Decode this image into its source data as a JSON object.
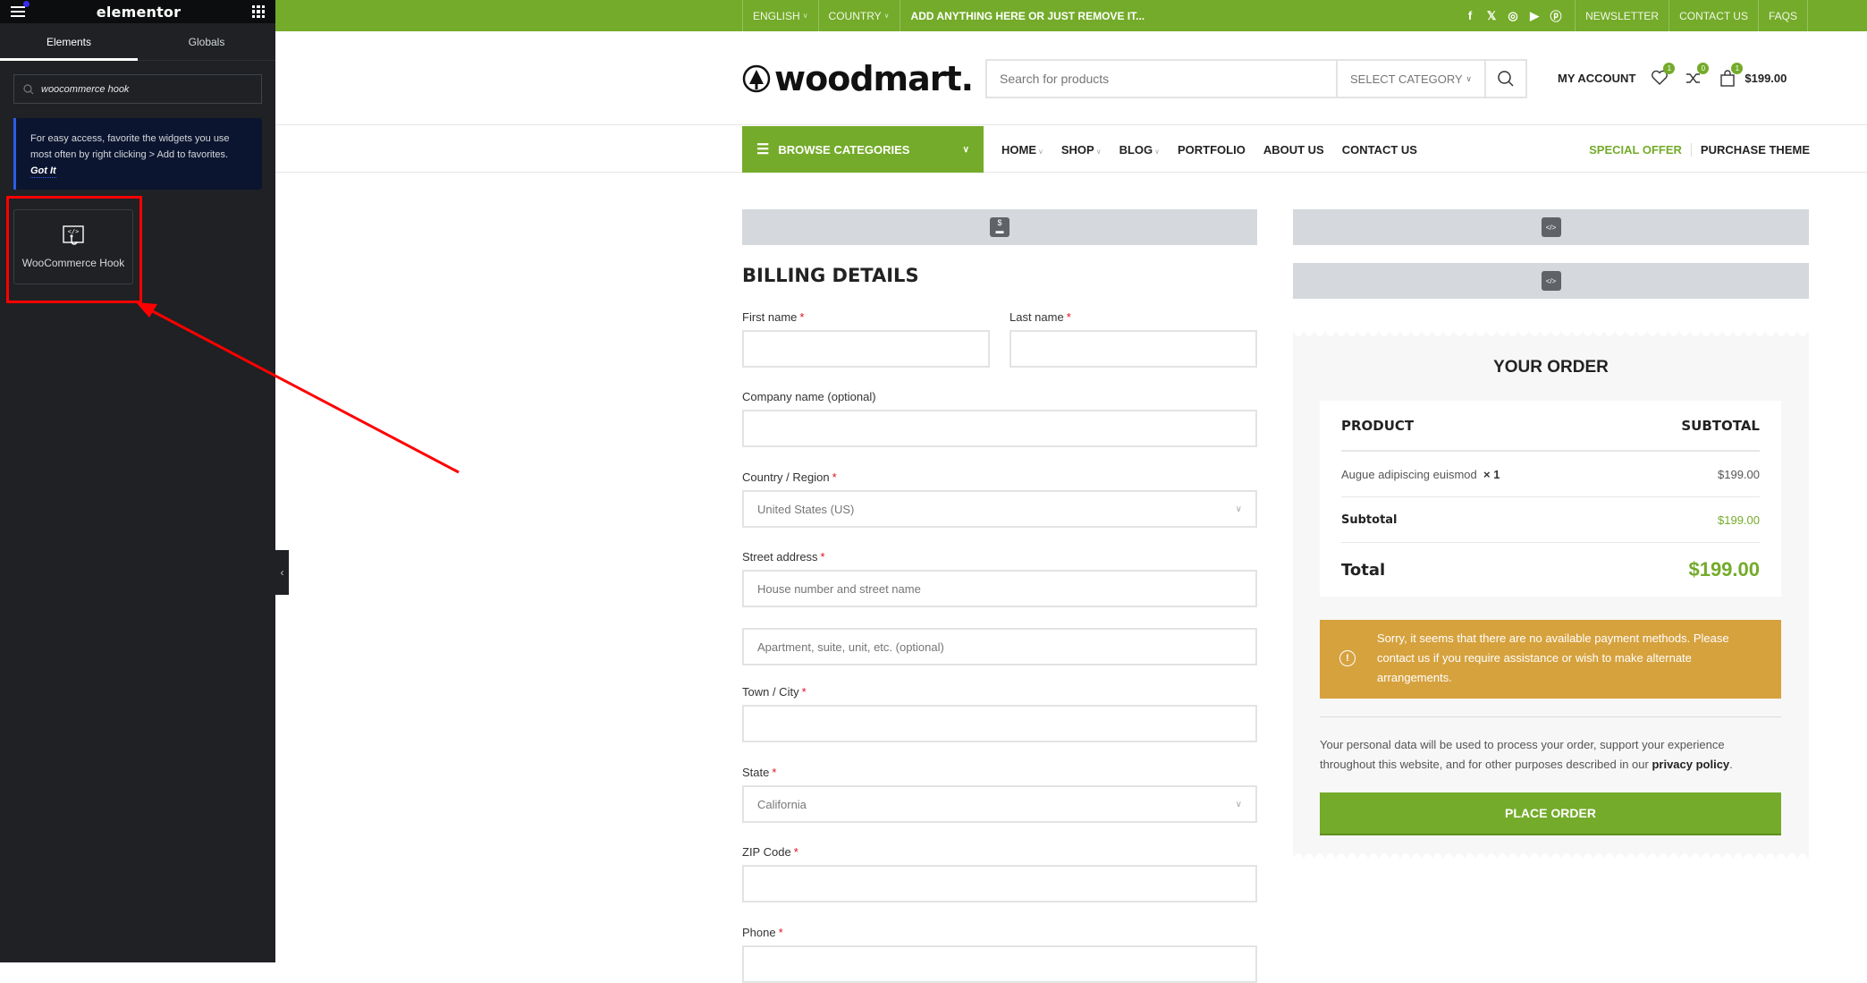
{
  "editor": {
    "brand": "elementor",
    "tabs": [
      "Elements",
      "Globals"
    ],
    "search_value": "woocommerce hook",
    "tip_text": "For easy access, favorite the widgets you use most often by right clicking > Add to favorites.",
    "tip_action": "Got It",
    "widget_label": "WooCommerce Hook"
  },
  "topbar": {
    "language": "ENGLISH",
    "country": "COUNTRY",
    "promo": "ADD ANYTHING HERE OR JUST REMOVE IT...",
    "social": [
      "f",
      "𝕏",
      "◎",
      "▶",
      "ⓟ"
    ],
    "links": [
      "NEWSLETTER",
      "CONTACT US",
      "FAQS"
    ]
  },
  "header": {
    "logo": "woodmart.",
    "search_placeholder": "Search for products",
    "category": "SELECT CATEGORY",
    "account": "MY ACCOUNT",
    "wishlist_count": "1",
    "compare_count": "0",
    "cart_count": "1",
    "cart_total": "$199.00"
  },
  "nav": {
    "browse": "BROWSE CATEGORIES",
    "items": [
      "HOME",
      "SHOP",
      "BLOG",
      "PORTFOLIO",
      "ABOUT US",
      "CONTACT US"
    ],
    "special": "SPECIAL OFFER",
    "purchase": "PURCHASE THEME"
  },
  "billing": {
    "title": "BILLING DETAILS",
    "first_name": "First name",
    "last_name": "Last name",
    "company": "Company name (optional)",
    "country_label": "Country / Region",
    "country_value": "United States (US)",
    "street_label": "Street address",
    "street_ph1": "House number and street name",
    "street_ph2": "Apartment, suite, unit, etc. (optional)",
    "city": "Town / City",
    "state_label": "State",
    "state_value": "California",
    "zip": "ZIP Code",
    "phone": "Phone",
    "required": "*"
  },
  "order": {
    "title": "YOUR ORDER",
    "col_product": "PRODUCT",
    "col_subtotal": "SUBTOTAL",
    "item_name": "Augue adipiscing euismod",
    "item_qty": "× 1",
    "item_price": "$199.00",
    "subtotal_label": "Subtotal",
    "subtotal_value": "$199.00",
    "total_label": "Total",
    "total_value": "$199.00",
    "notice": "Sorry, it seems that there are no available payment methods. Please contact us if you require assistance or wish to make alternate arrangements.",
    "privacy_text": "Your personal data will be used to process your order, support your experience throughout this website, and for other purposes described in our ",
    "privacy_link": "privacy policy",
    "privacy_end": ".",
    "place_order": "PLACE ORDER"
  },
  "colors": {
    "accent": "#74ab2a",
    "notice": "#d6a23e",
    "panel": "#1f2124",
    "annotation": "#ff0000"
  }
}
